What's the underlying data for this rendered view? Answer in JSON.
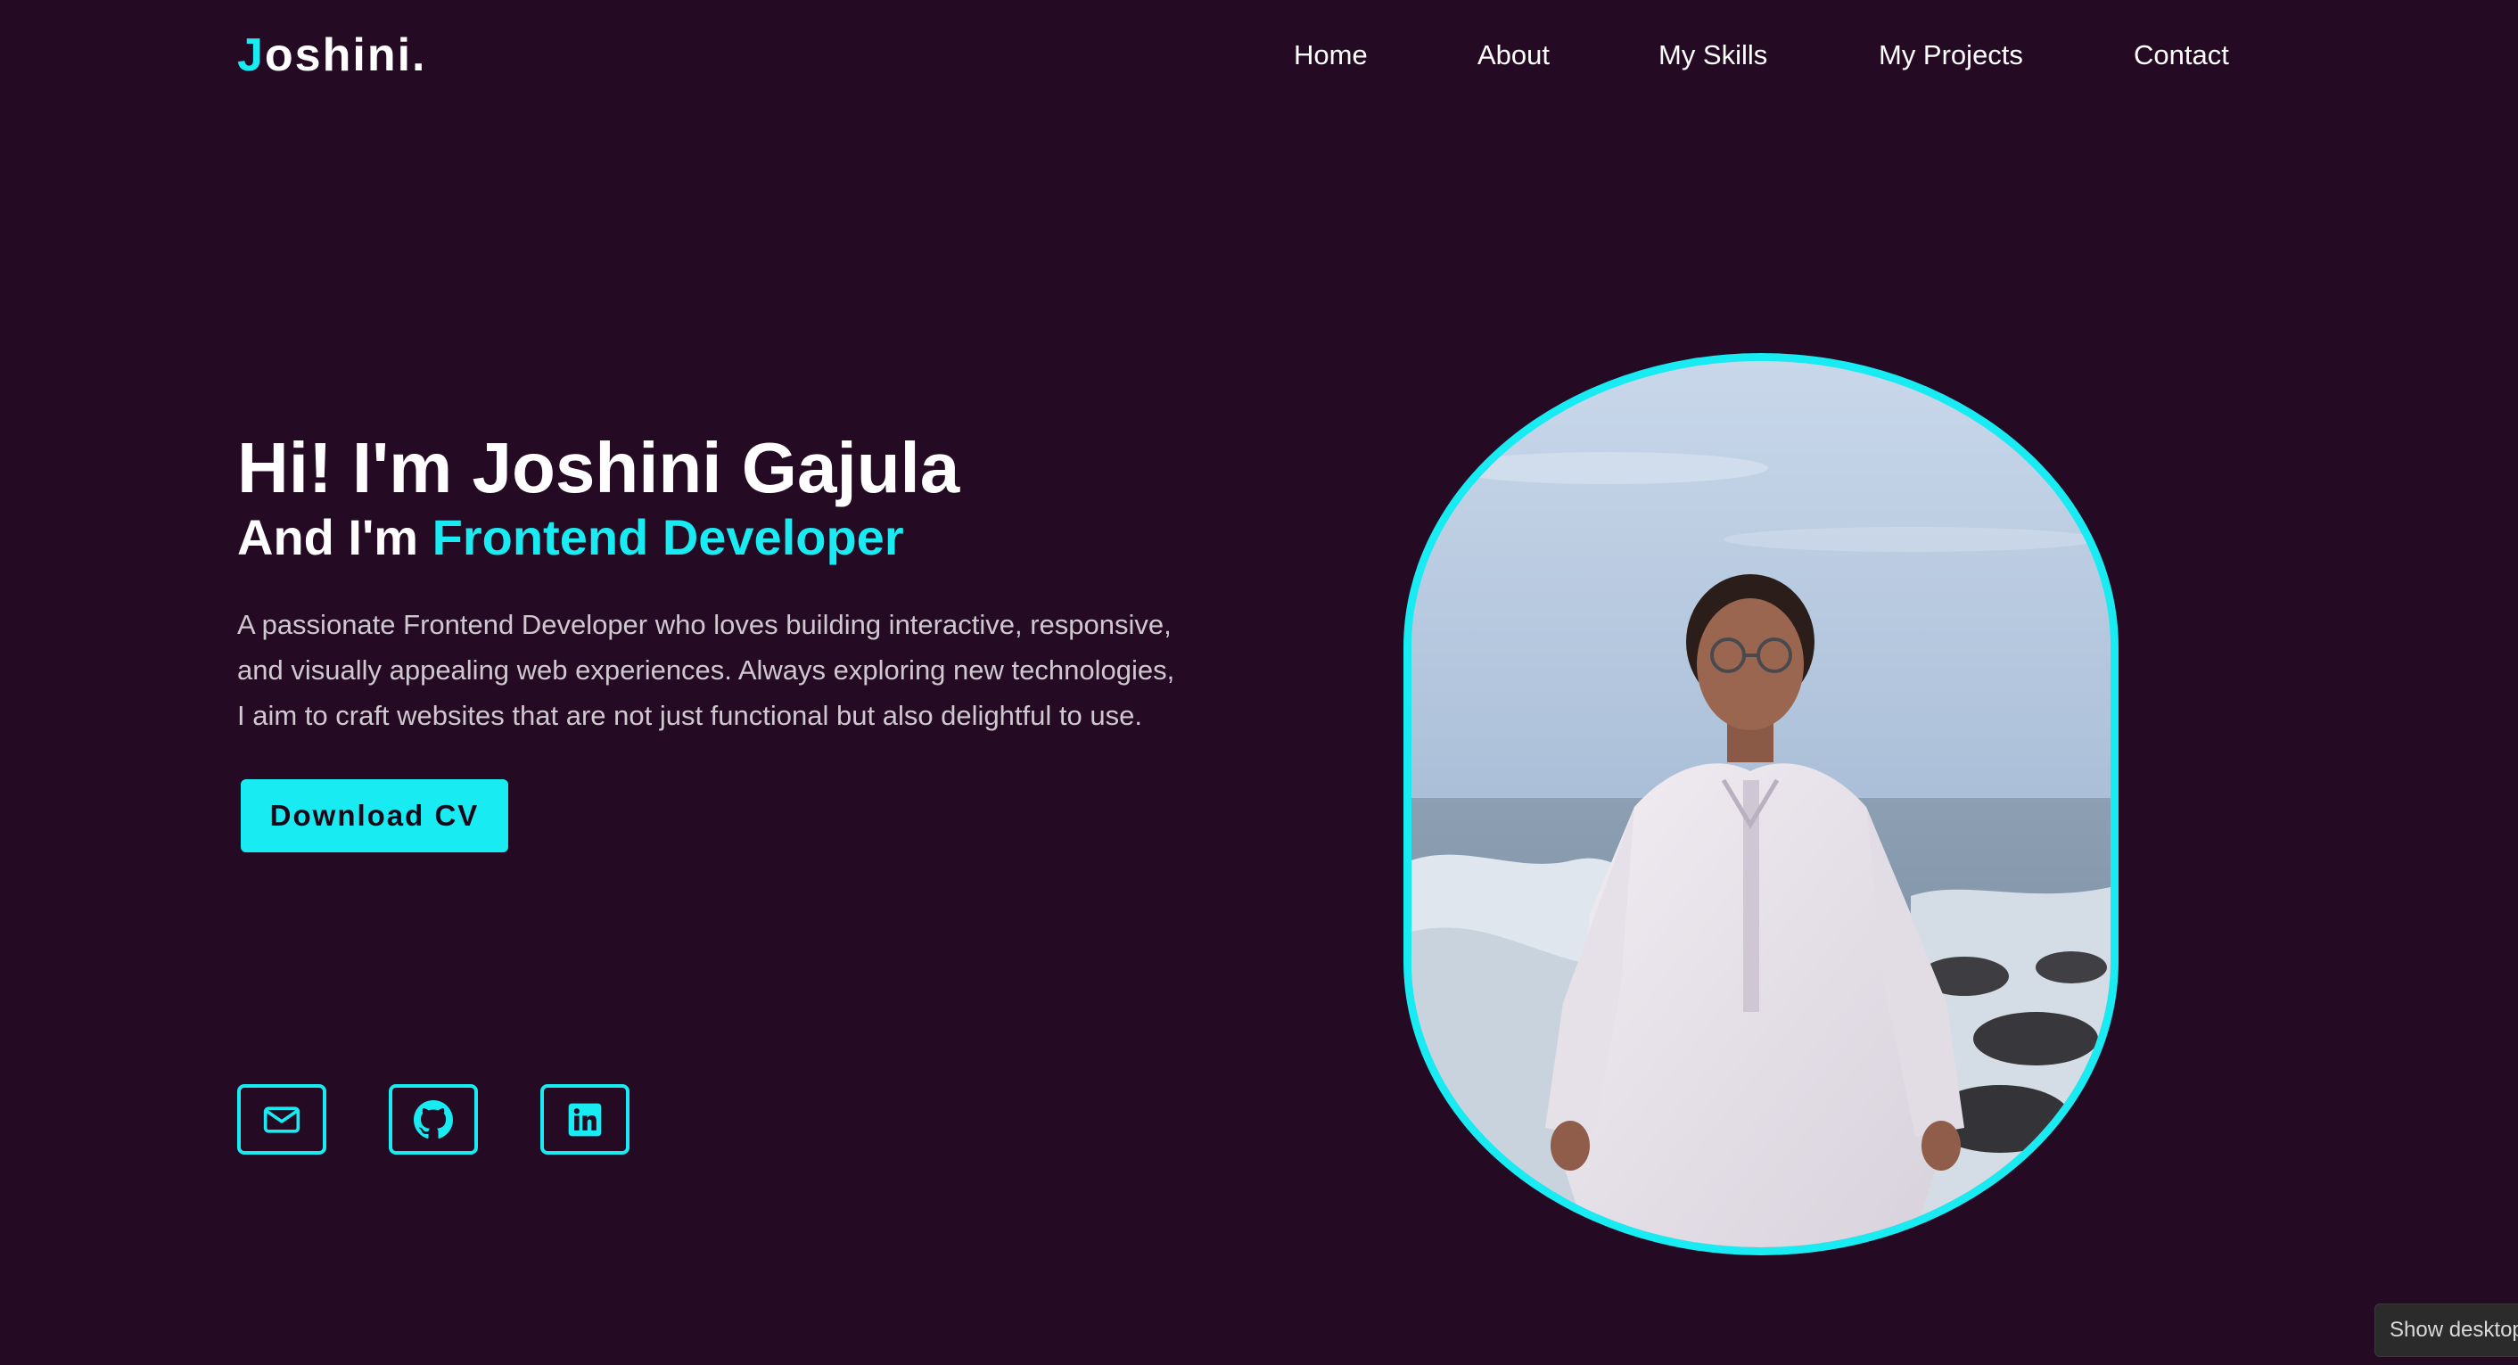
{
  "brand": {
    "initial": "J",
    "rest": "oshini."
  },
  "nav": {
    "items": [
      {
        "label": "Home"
      },
      {
        "label": "About"
      },
      {
        "label": "My Skills"
      },
      {
        "label": "My Projects"
      },
      {
        "label": "Contact"
      }
    ]
  },
  "hero": {
    "greeting": "Hi! I'm Joshini Gajula",
    "role_prefix": "And I'm ",
    "role_highlight": "Frontend Developer",
    "bio_lines": [
      "A passionate Frontend Developer who loves building interactive, responsive,",
      "and visually appealing web experiences. Always exploring new technologies,",
      "I aim to craft websites that are not just functional but also delightful to use."
    ],
    "cv_button": "Download CV"
  },
  "social": {
    "icons": [
      "mail-icon",
      "github-icon",
      "linkedin-icon"
    ]
  },
  "portrait": {
    "subject": "photo-portrait"
  },
  "tooltip": {
    "text": "Show desktop"
  },
  "colors": {
    "background": "#250a23",
    "accent": "#19ebf2",
    "text": "#ffffff",
    "muted_text": "#cfc8d0"
  }
}
